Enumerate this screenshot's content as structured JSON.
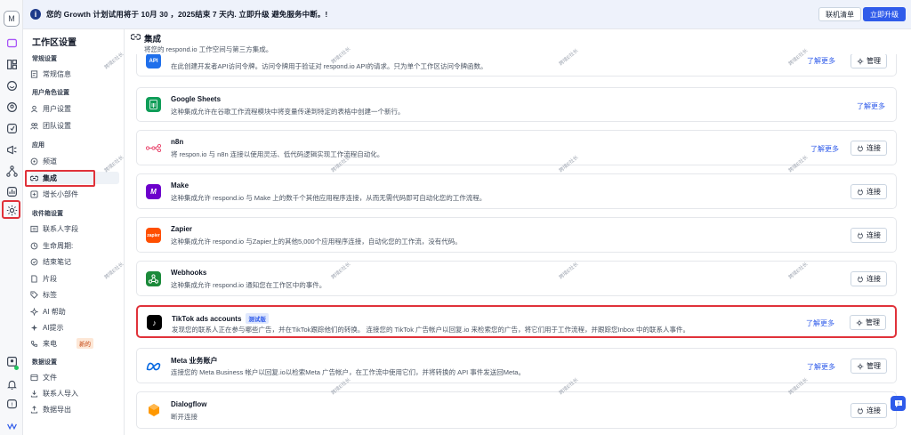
{
  "rail": {
    "avatar_letter": "M",
    "icons": [
      "logo-icon",
      "dashboard-icon",
      "inbox-icon",
      "contacts-icon",
      "broadcast-icon",
      "workflows-icon",
      "reports-icon",
      "settings-icon",
      "profile-icon",
      "notifications-icon",
      "help-icon",
      "brand-icon"
    ]
  },
  "banner": {
    "text": "您的 Growth 计划试用将于 10月 30 ，2025结束 7 天内. 立即升级 避免服务中断。!",
    "list_button": "联机清单",
    "upgrade_button": "立即升级"
  },
  "sidebar": {
    "title": "工作区设置",
    "sections": [
      {
        "label": "常规设置",
        "items": [
          {
            "label": "常规信息",
            "icon": "document-icon"
          }
        ]
      },
      {
        "label": "用户角色设置",
        "items": [
          {
            "label": "用户设置",
            "icon": "user-icon"
          },
          {
            "label": "团队设置",
            "icon": "team-icon"
          }
        ]
      },
      {
        "label": "应用",
        "items": [
          {
            "label": "频道",
            "icon": "channel-icon"
          },
          {
            "label": "集成",
            "icon": "integration-icon"
          },
          {
            "label": "增长小部件",
            "icon": "widget-icon"
          }
        ]
      },
      {
        "label": "收件箱设置",
        "items": [
          {
            "label": "联系人字段",
            "icon": "field-icon"
          },
          {
            "label": "生命周期:",
            "icon": "lifecycle-icon"
          },
          {
            "label": "结束笔记",
            "icon": "note-icon"
          },
          {
            "label": "片段",
            "icon": "snippet-icon"
          },
          {
            "label": "标签",
            "icon": "tag-icon"
          },
          {
            "label": "AI 帮助",
            "icon": "ai-help-icon"
          },
          {
            "label": "AI提示",
            "icon": "ai-prompt-icon"
          },
          {
            "label": "来电",
            "icon": "phone-icon",
            "badge": "新的"
          }
        ]
      },
      {
        "label": "数据设置",
        "items": [
          {
            "label": "文件",
            "icon": "file-icon"
          },
          {
            "label": "联系人导入",
            "icon": "import-icon"
          },
          {
            "label": "数据导出",
            "icon": "export-icon"
          }
        ]
      }
    ]
  },
  "header": {
    "title": "集成",
    "subtitle": "将您的 respond.io 工作空间与第三方集成。"
  },
  "integrations": [
    {
      "name": "API",
      "desc": "在此创建开发者API访问令牌。访问令牌用于验证对 respond.io API的请求。只为单个工作区访问令牌函数。",
      "learn": "了解更多",
      "action": "管理",
      "logo": "api-icon",
      "color": "#1f6feb"
    },
    {
      "name": "Google Sheets",
      "desc": "这种集成允许在谷歌工作流程模块中将变量传递到特定的表格中创建一个新行。",
      "learn": "了解更多",
      "action": "",
      "logo": "google-sheets-icon",
      "color": "#0f9d58"
    },
    {
      "name": "n8n",
      "desc": "将 respon.io 与 n8n 连接以使用灵活、低代码逻辑实现工作流程自动化。",
      "learn": "了解更多",
      "action": "连接",
      "logo": "n8n-icon",
      "color": "#ea4b71"
    },
    {
      "name": "Make",
      "desc": "这种集成允许 respond.io 与 Make 上的数千个其他应用程序连接，从而无需代码即可自动化您的工作流程。",
      "learn": "",
      "action": "连接",
      "logo": "make-icon",
      "color": "#6d00cc"
    },
    {
      "name": "Zapier",
      "desc": "这种集成允许 respond.io 与Zapier上的其他5,000个应用程序连接，自动化您的工作流，没有代码。",
      "learn": "",
      "action": "连接",
      "logo": "zapier-icon",
      "color": "#ff4f00"
    },
    {
      "name": "Webhooks",
      "desc": "这种集成允许 respond.io 通知您在工作区中的事件。",
      "learn": "",
      "action": "连接",
      "logo": "webhooks-icon",
      "color": "#1b8a3a"
    },
    {
      "name": "TikTok ads accounts",
      "badge": "测试版",
      "desc": "发现您的联系人正在参与哪些广告，并在TikTok跟踪他们的转换。 连接您的 TikTok 广告帐户以回复.io 来检索您的广告，将它们用于工作流程，并跟踪您Inbox 中的联系人事件。",
      "learn": "了解更多",
      "action": "管理",
      "logo": "tiktok-icon",
      "color": "#000000"
    },
    {
      "name": "Meta 业务账户",
      "desc": "连接您的 Meta Business 帐户以回复.io以检索Meta 广告帐户，在工作流中使用它们，并将转换的 API 事件发送回Meta。",
      "learn": "了解更多",
      "action": "管理",
      "logo": "meta-icon",
      "color": "#0668e1"
    },
    {
      "name": "Dialogflow",
      "desc": "断开连接",
      "learn": "",
      "action": "连接",
      "logo": "dialogflow-icon",
      "color": "#ff9800"
    }
  ],
  "watermark": "跨境E社长"
}
